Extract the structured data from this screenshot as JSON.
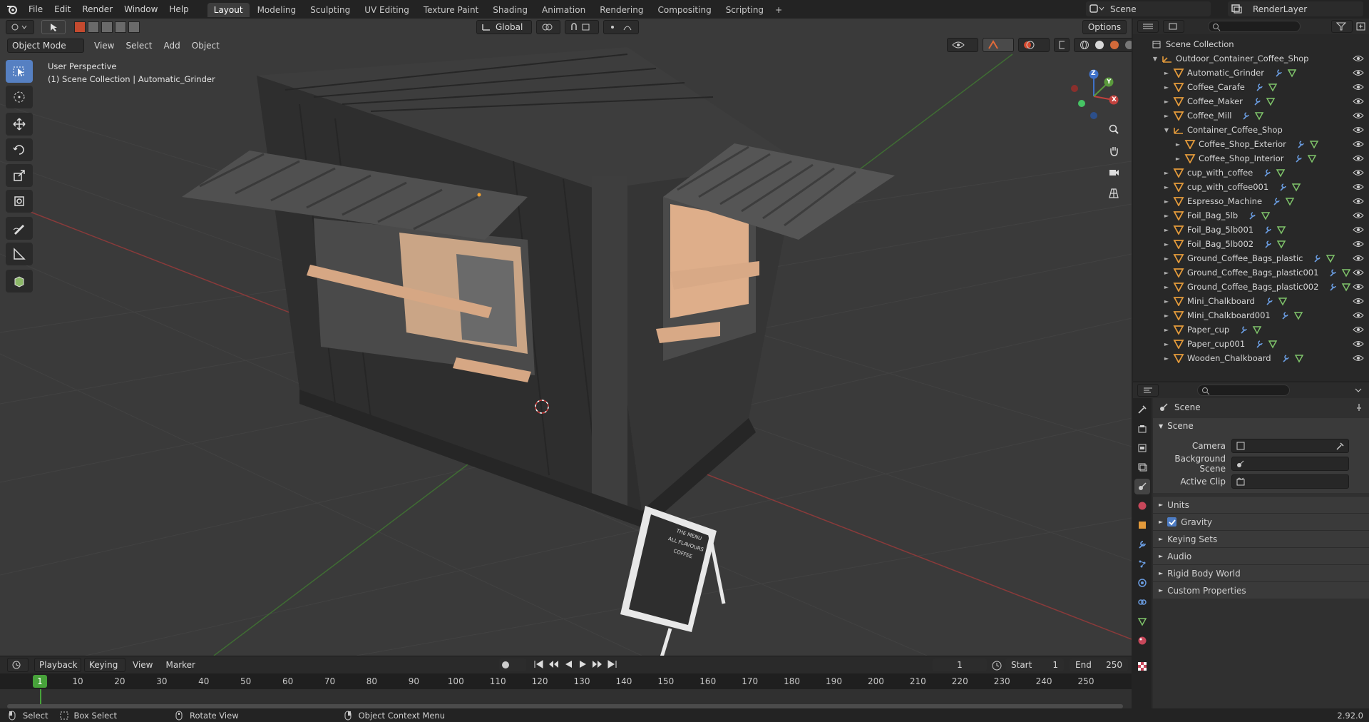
{
  "topbar": {
    "menu": [
      "File",
      "Edit",
      "Render",
      "Window",
      "Help"
    ],
    "workspaces": [
      "Layout",
      "Modeling",
      "Sculpting",
      "UV Editing",
      "Texture Paint",
      "Shading",
      "Animation",
      "Rendering",
      "Compositing",
      "Scripting"
    ],
    "active_workspace": "Layout",
    "add_workspace": "+",
    "scene": "Scene",
    "view_layer": "RenderLayer"
  },
  "viewport": {
    "mode": "Object Mode",
    "menu": [
      "View",
      "Select",
      "Add",
      "Object"
    ],
    "transform_orientation": "Global",
    "options_label": "Options",
    "perspective": "User Perspective",
    "collection_info": "(1) Scene Collection | Automatic_Grinder",
    "gizmo": {
      "x": "X",
      "y": "Y",
      "z": "Z"
    }
  },
  "chalkboard_text": [
    "THE MENU",
    "ALL FLAVOURS",
    "COFFEE"
  ],
  "timeline": {
    "menu": [
      "Playback",
      "Keying",
      "View",
      "Marker"
    ],
    "current_frame": "1",
    "start_label": "Start",
    "start": "1",
    "end_label": "End",
    "end": "250",
    "ticks": [
      "1",
      "10",
      "20",
      "30",
      "40",
      "50",
      "60",
      "70",
      "80",
      "90",
      "100",
      "110",
      "120",
      "130",
      "140",
      "150",
      "160",
      "170",
      "180",
      "190",
      "200",
      "210",
      "220",
      "230",
      "240",
      "250"
    ]
  },
  "outliner": {
    "root": "Scene Collection",
    "collection": "Outdoor_Container_Coffee_Shop",
    "items": [
      {
        "name": "Automatic_Grinder",
        "depth": 2
      },
      {
        "name": "Coffee_Carafe",
        "depth": 2
      },
      {
        "name": "Coffee_Maker",
        "depth": 2
      },
      {
        "name": "Coffee_Mill",
        "depth": 2
      },
      {
        "name": "Container_Coffee_Shop",
        "depth": 2,
        "expanded": true,
        "empty": true
      },
      {
        "name": "Coffee_Shop_Exterior",
        "depth": 3
      },
      {
        "name": "Coffee_Shop_Interior",
        "depth": 3
      },
      {
        "name": "cup_with_coffee",
        "depth": 2
      },
      {
        "name": "cup_with_coffee001",
        "depth": 2
      },
      {
        "name": "Espresso_Machine",
        "depth": 2
      },
      {
        "name": "Foil_Bag_5lb",
        "depth": 2
      },
      {
        "name": "Foil_Bag_5lb001",
        "depth": 2
      },
      {
        "name": "Foil_Bag_5lb002",
        "depth": 2
      },
      {
        "name": "Ground_Coffee_Bags_plastic",
        "depth": 2
      },
      {
        "name": "Ground_Coffee_Bags_plastic001",
        "depth": 2
      },
      {
        "name": "Ground_Coffee_Bags_plastic002",
        "depth": 2
      },
      {
        "name": "Mini_Chalkboard",
        "depth": 2
      },
      {
        "name": "Mini_Chalkboard001",
        "depth": 2
      },
      {
        "name": "Paper_cup",
        "depth": 2
      },
      {
        "name": "Paper_cup001",
        "depth": 2
      },
      {
        "name": "Wooden_Chalkboard",
        "depth": 2
      }
    ]
  },
  "properties": {
    "context": "Scene",
    "panel": "Scene",
    "fields": [
      {
        "label": "Camera",
        "value": ""
      },
      {
        "label": "Background Scene",
        "value": ""
      },
      {
        "label": "Active Clip",
        "value": ""
      }
    ],
    "subpanels": [
      "Units",
      "Gravity",
      "Keying Sets",
      "Audio",
      "Rigid Body World",
      "Custom Properties"
    ],
    "gravity_checked": true
  },
  "statusbar": {
    "items": [
      "Select",
      "Box Select",
      "Rotate View",
      "Object Context Menu"
    ],
    "version": "2.92.0"
  },
  "colors": {
    "accent": "#5680c2",
    "object_orange": "#e39a3b",
    "x_axis": "#c2413d",
    "y_axis": "#5a9a3c",
    "z_axis": "#3f71c9"
  }
}
